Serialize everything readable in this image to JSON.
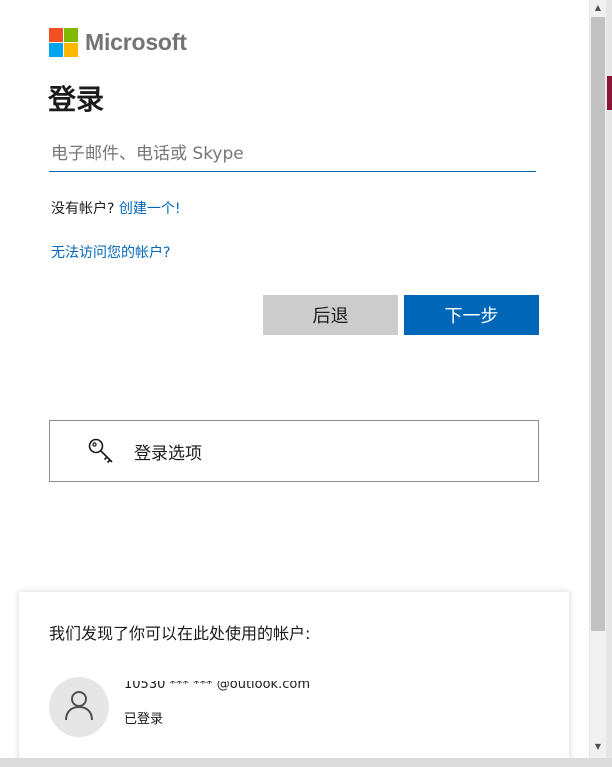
{
  "brand": {
    "name": "Microsoft",
    "colors": {
      "red": "#f25022",
      "green": "#7fba00",
      "blue": "#00a4ef",
      "yellow": "#ffb900",
      "accent": "#0067b8"
    }
  },
  "title": "登录",
  "email_input": {
    "placeholder": "电子邮件、电话或 Skype",
    "value": ""
  },
  "no_account": {
    "text": "没有帐户?",
    "link": "创建一个!"
  },
  "cant_access_link": "无法访问您的帐户?",
  "buttons": {
    "back": "后退",
    "next": "下一步"
  },
  "signin_options": {
    "icon": "key-icon",
    "label": "登录选项"
  },
  "accounts": {
    "heading": "我们发现了你可以在此处使用的帐户:",
    "items": [
      {
        "icon": "user-icon",
        "name": "10530 *** *** @outlook.com",
        "status": "已登录"
      }
    ]
  },
  "scrollbar": {
    "up_icon": "scroll-up-arrow-icon",
    "down_icon": "scroll-down-arrow-icon"
  }
}
